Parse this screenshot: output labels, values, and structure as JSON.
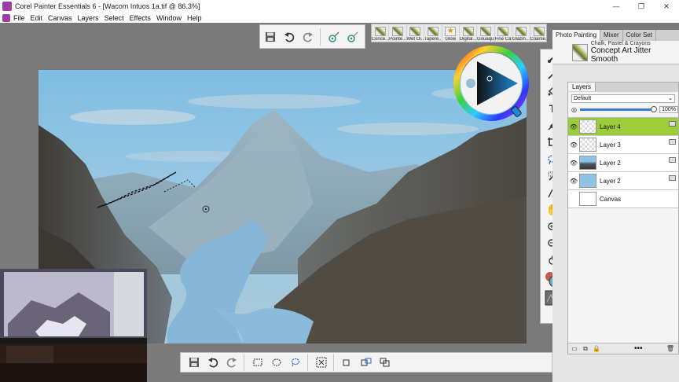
{
  "window": {
    "title": "Corel Painter Essentials 6 - [Wacom Intuos 1a.tif @ 86.3%]",
    "controls": {
      "minimize": "—",
      "restore": "❐",
      "close": "✕"
    }
  },
  "menu": {
    "items": [
      "File",
      "Edit",
      "Canvas",
      "Layers",
      "Select",
      "Effects",
      "Window",
      "Help"
    ]
  },
  "top_toolbar": {
    "icons": [
      "save-icon",
      "undo-icon",
      "redo-icon",
      "brush-ghost-icon",
      "brush-cursor-icon"
    ]
  },
  "brush_library": {
    "items": [
      "Conce...",
      "Pointe...",
      "Wet Oi...",
      "Tapere...",
      "Glow",
      "Digital...",
      "Gouaqu...",
      "Fine Ca...",
      "Glazin...",
      "Coarse..."
    ]
  },
  "right_panel": {
    "tabs": [
      "Photo Painting",
      "Mixer",
      "Color Set"
    ],
    "brush_category": "Chalk, Pastel & Crayons",
    "brush_variant": "Concept Art Jitter Smooth"
  },
  "layers": {
    "tab_label": "Layers",
    "blend_mode": "Default",
    "opacity": "100%",
    "opacity_value": 1.0,
    "items": [
      {
        "name": "Layer 4",
        "selected": true
      },
      {
        "name": "Layer 3",
        "selected": false
      },
      {
        "name": "Layer 2",
        "selected": false
      },
      {
        "name": "Layer 2",
        "selected": false
      },
      {
        "name": "Canvas",
        "selected": false
      }
    ],
    "footer_more": "•••"
  },
  "toolbox": {
    "tools": [
      "brush-tool-icon",
      "dropper-tool-icon",
      "paint-bucket-icon",
      "text-tool-icon",
      "transform-tool-icon",
      "crop-tool-icon",
      "lasso-tool-icon",
      "magic-wand-icon",
      "clone-tool-icon",
      "grabber-hand-icon",
      "zoom-in-icon",
      "zoom-out-icon",
      "rotate-page-icon",
      "main-color-icon",
      "paper-texture-icon"
    ]
  },
  "bottom_toolbar": {
    "icons": [
      "save-icon",
      "undo-icon",
      "redo-icon",
      "rect-select-icon",
      "oval-select-icon",
      "lasso-select-icon",
      "select-all-icon",
      "add-selection-icon",
      "subtract-selection-icon",
      "intersect-selection-icon"
    ]
  },
  "colors": {
    "selected_layer": "#9dcc3a",
    "sky": "#8ec3e4",
    "accent_blue": "#3a7bd5"
  }
}
